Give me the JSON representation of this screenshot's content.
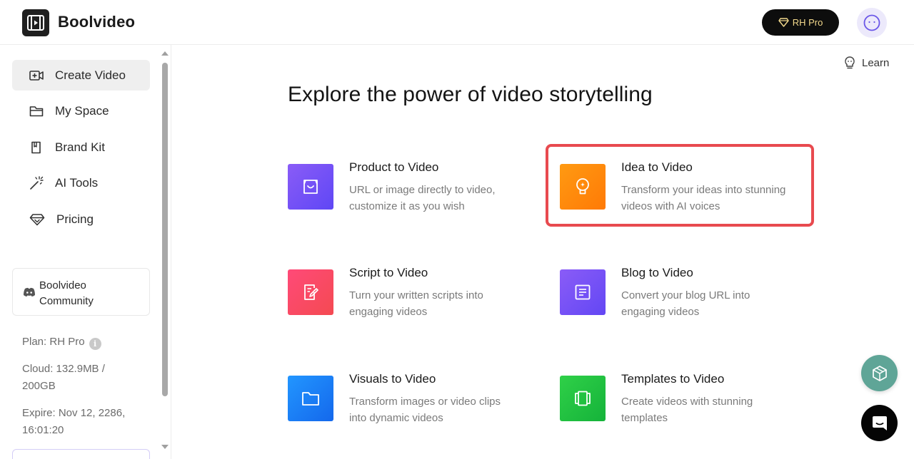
{
  "header": {
    "brand": "Boolvideo",
    "pro_button": {
      "label": "RH Pro",
      "icon": "diamond-icon"
    },
    "avatar_icon": "smiley-icon"
  },
  "sidebar": {
    "items": [
      {
        "label": "Create Video",
        "icon": "video-add-icon",
        "active": true
      },
      {
        "label": "My Space",
        "icon": "folder-icon",
        "active": false
      },
      {
        "label": "Brand Kit",
        "icon": "book-icon",
        "active": false
      },
      {
        "label": "AI Tools",
        "icon": "magic-wand-icon",
        "active": false
      },
      {
        "label": "Pricing",
        "icon": "diamond-icon",
        "active": false
      }
    ],
    "community": {
      "line1": "Boolvideo",
      "line2": "Community",
      "icon": "discord-icon"
    },
    "plan": {
      "plan": "Plan: RH Pro",
      "cloud_1": "Cloud: 132.9MB /",
      "cloud_2": "200GB",
      "expire_1": "Expire: Nov 12, 2286,",
      "expire_2": "16:01:20",
      "info_glyph": "i"
    }
  },
  "main": {
    "learn": "Learn",
    "headline": "Explore the power of video storytelling",
    "cards": [
      {
        "title": "Product to Video",
        "desc_1": "URL or image directly to video,",
        "desc_2": "customize it as you wish",
        "color": "#6b4ff6",
        "icon": "shopping-bag-icon"
      },
      {
        "title": "Idea to Video",
        "desc_1": "Transform your ideas into stunning",
        "desc_2": "videos with AI voices",
        "color": "#ff8a0a",
        "icon": "lightbulb-icon",
        "highlighted": true
      },
      {
        "title": "Script to Video",
        "desc_1": "Turn your written scripts into",
        "desc_2": "engaging videos",
        "color": "#f74863",
        "icon": "script-edit-icon"
      },
      {
        "title": "Blog to Video",
        "desc_1": "Convert your blog URL into",
        "desc_2": "engaging videos",
        "color": "#7350f5",
        "icon": "document-icon"
      },
      {
        "title": "Visuals to Video",
        "desc_1": "Transform images or video clips",
        "desc_2": "into dynamic videos",
        "color": "#1c7ef5",
        "icon": "folder-icon"
      },
      {
        "title": "Templates to Video",
        "desc_1": "Create videos with stunning",
        "desc_2": "templates",
        "color": "#21c23f",
        "icon": "film-frames-icon"
      }
    ]
  },
  "floating": {
    "assistant_icon": "cube-icon",
    "chat_icon": "chat-bubble-icon"
  },
  "colors": {
    "highlight": "#e84a4f",
    "active_nav": "#efefef",
    "pro_text": "#f3d98c"
  }
}
